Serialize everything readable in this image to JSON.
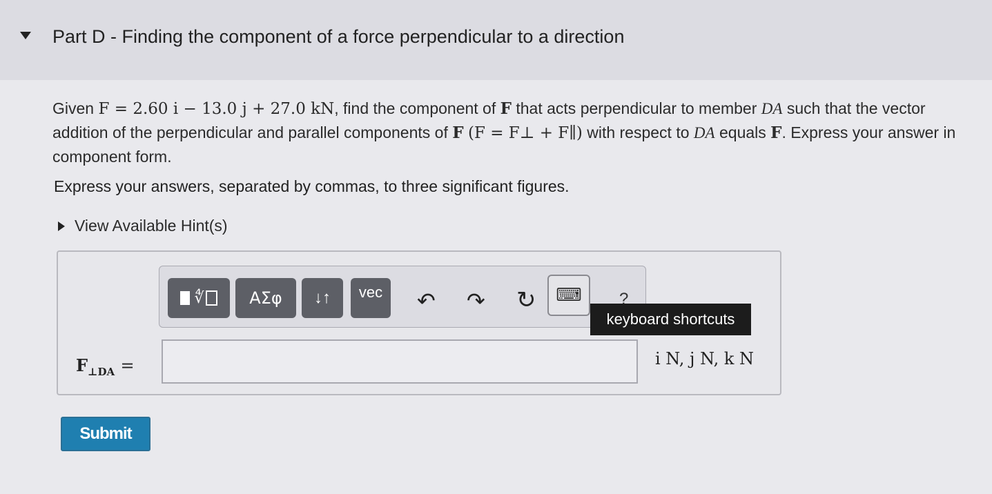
{
  "part": {
    "title": "Part D - Finding the component of a force perpendicular to a direction"
  },
  "problem": {
    "given_word": "Given",
    "force_expression": "F = 2.60 i − 13.0 j + 27.0 kN",
    "text_1": ", find the component of",
    "F_symbol": "F",
    "text_2": "that acts perpendicular to member",
    "member": "DA",
    "text_3": "such that the vector addition of the perpendicular and parallel components of",
    "vector_relation": "(F = F⊥ + F∥)",
    "text_4": "with respect to",
    "member_2": "DA",
    "text_5": "equals",
    "text_6": ". Express your answer in component form."
  },
  "instruction": "Express your answers, separated by commas, to three significant figures.",
  "hint": {
    "label": "View Available Hint(s)"
  },
  "toolbar": {
    "greek_label": "ΑΣφ",
    "arrows_label": "↓↑",
    "vec_label": "vec",
    "undo_icon": "↶",
    "redo_icon": "↷",
    "reset_icon": "↻",
    "keyboard_glyph": "⌨",
    "help_label": "?",
    "tooltip": "keyboard shortcuts"
  },
  "answer": {
    "label_main": "F",
    "label_sub": "⊥DA",
    "equals": "=",
    "value": "",
    "units": "i N, j N, k N"
  },
  "submit": {
    "label": "Submit"
  },
  "colors": {
    "submit_bg": "#1f7fb0",
    "tool_button_bg": "#5d5f66",
    "tooltip_bg": "#1c1c1c"
  }
}
